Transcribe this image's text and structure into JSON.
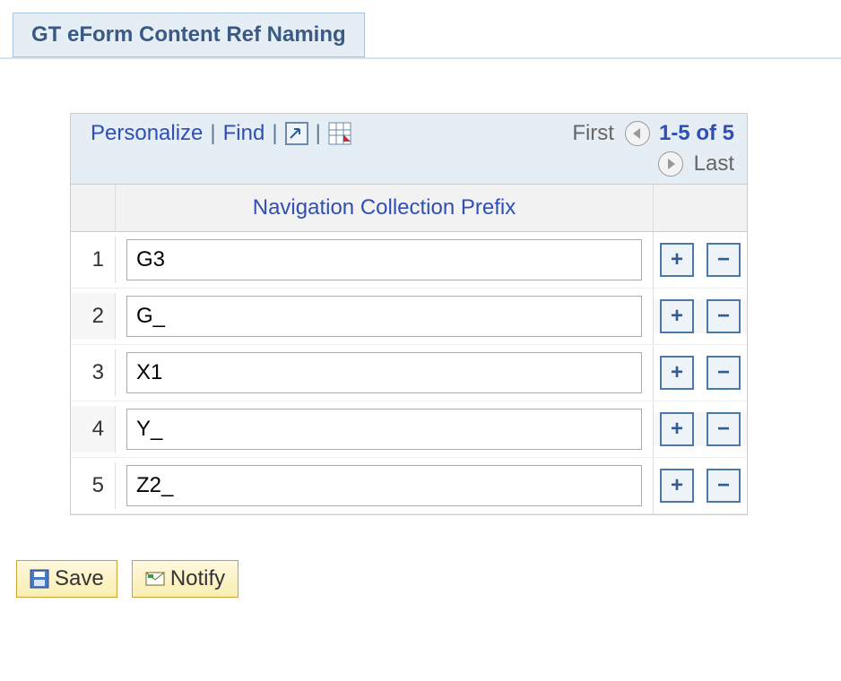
{
  "header": {
    "tab_label": "GT eForm Content Ref Naming"
  },
  "grid": {
    "toolbar": {
      "personalize": "Personalize",
      "find": "Find",
      "first": "First",
      "range": "1-5 of 5",
      "last": "Last"
    },
    "column_header": "Navigation Collection Prefix",
    "rows": [
      {
        "num": "1",
        "value": "G3"
      },
      {
        "num": "2",
        "value": "G_"
      },
      {
        "num": "3",
        "value": "X1"
      },
      {
        "num": "4",
        "value": "Y_"
      },
      {
        "num": "5",
        "value": "Z2_"
      }
    ]
  },
  "footer": {
    "save": "Save",
    "notify": "Notify"
  },
  "glyphs": {
    "plus": "+",
    "minus": "−"
  }
}
